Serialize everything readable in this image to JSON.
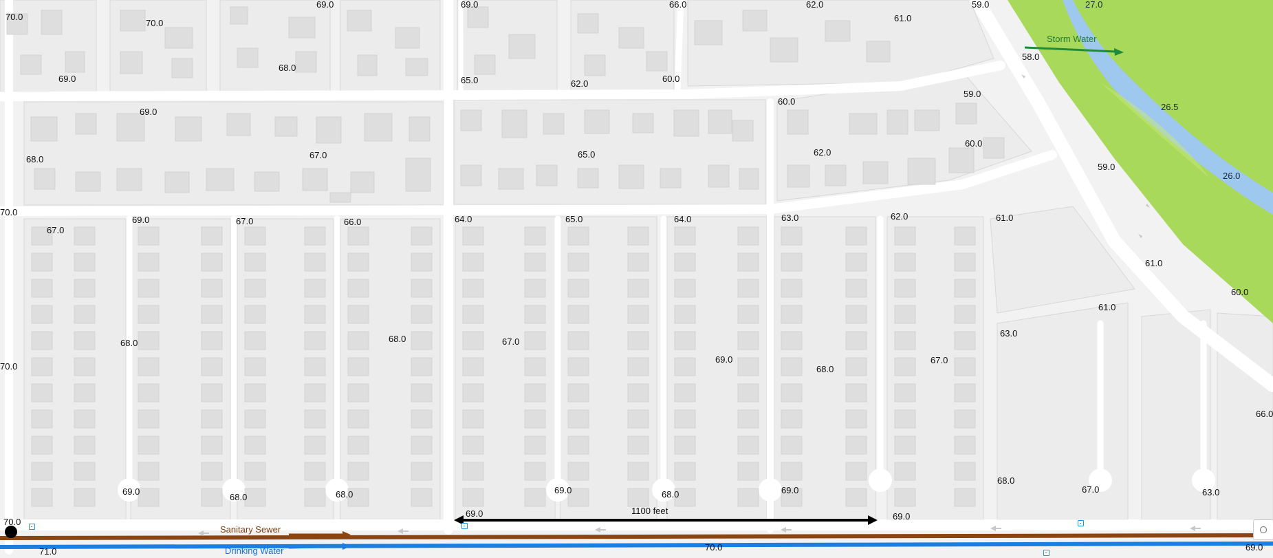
{
  "colors": {
    "background": "#f2f2f2",
    "block": "#ececec",
    "road": "#ffffff",
    "building": "#dedede",
    "park": "#a8d95a",
    "river": "#9ec8ee",
    "sanitary_sewer": "#8b4513",
    "drinking_water": "#1a7fe0",
    "storm_water": "#1e8a3a",
    "scale_bar": "#000000"
  },
  "legend": {
    "storm_water": "Storm Water",
    "sanitary_sewer": "Sanitary Sewer",
    "drinking_water": "Drinking Water"
  },
  "scale": {
    "label": "1100 feet"
  },
  "elevations": [
    "70.0",
    "70.0",
    "69.0",
    "69.0",
    "68.0",
    "69.0",
    "65.0",
    "66.0",
    "62.0",
    "61.0",
    "62.0",
    "60.0",
    "59.0",
    "58.0",
    "69.0",
    "68.0",
    "67.0",
    "65.0",
    "60.0",
    "59.0",
    "62.0",
    "60.0",
    "59.0",
    "70.0",
    "67.0",
    "69.0",
    "67.0",
    "66.0",
    "64.0",
    "65.0",
    "64.0",
    "63.0",
    "62.0",
    "61.0",
    "61.0",
    "60.0",
    "68.0",
    "68.0",
    "67.0",
    "69.0",
    "68.0",
    "67.0",
    "63.0",
    "61.0",
    "70.0",
    "66.0",
    "69.0",
    "68.0",
    "68.0",
    "69.0",
    "68.0",
    "69.0",
    "68.0",
    "67.0",
    "63.0",
    "69.0",
    "69.0",
    "70.0",
    "71.0",
    "70.0",
    "69.0"
  ],
  "water_levels": [
    "27.0",
    "26.5",
    "26.0"
  ],
  "icons": {
    "origin_marker": "black-dot-icon",
    "valve_markers": "water-valve-icon",
    "flow_arrows": "flow-direction-arrow-icon",
    "location_control": "locate-icon"
  }
}
